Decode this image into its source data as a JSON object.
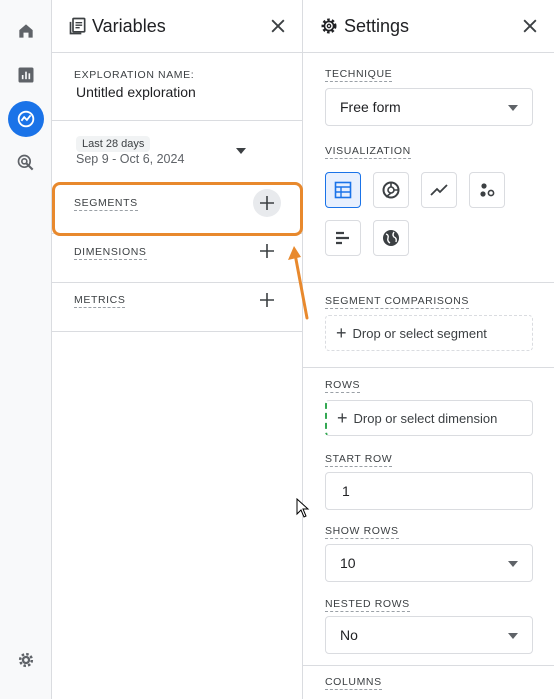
{
  "rail": {
    "items": [
      {
        "icon": "home-icon"
      },
      {
        "icon": "reports-icon"
      },
      {
        "icon": "explore-icon",
        "active": true
      },
      {
        "icon": "advertising-icon"
      }
    ],
    "bottom_icon": "settings-gear-icon"
  },
  "variables": {
    "title": "Variables",
    "exploration_name_label": "EXPLORATION NAME:",
    "exploration_name": "Untitled exploration",
    "date_chip": "Last 28 days",
    "date_range": "Sep 9 - Oct 6, 2024",
    "segments_label": "SEGMENTS",
    "dimensions_label": "DIMENSIONS",
    "metrics_label": "METRICS"
  },
  "settings": {
    "title": "Settings",
    "technique_label": "TECHNIQUE",
    "technique_value": "Free form",
    "visualization_label": "VISUALIZATION",
    "segment_comparisons_label": "SEGMENT COMPARISONS",
    "segment_drop_placeholder": "Drop or select segment",
    "rows_label": "ROWS",
    "rows_drop_placeholder": "Drop or select dimension",
    "start_row_label": "START ROW",
    "start_row_value": "1",
    "show_rows_label": "SHOW ROWS",
    "show_rows_value": "10",
    "nested_rows_label": "NESTED ROWS",
    "nested_rows_value": "No",
    "columns_label": "COLUMNS"
  },
  "colors": {
    "accent": "#1a73e8",
    "highlight": "#e8892d",
    "divider": "#dadce0"
  }
}
